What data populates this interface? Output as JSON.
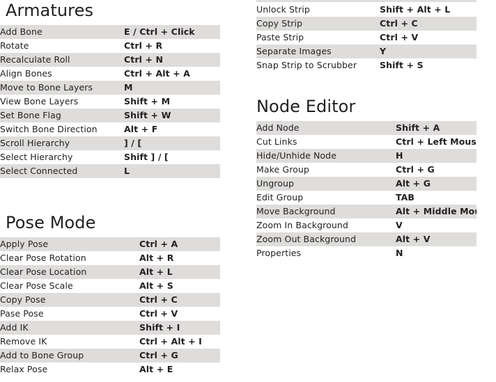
{
  "sections": [
    {
      "id": "armatures",
      "title": "Armatures",
      "rows": [
        {
          "action": "Add Bone",
          "keys": "E / Ctrl + Click"
        },
        {
          "action": "Rotate",
          "keys": "Ctrl + R"
        },
        {
          "action": "Recalculate Roll",
          "keys": "Ctrl + N"
        },
        {
          "action": "Align Bones",
          "keys": "Ctrl + Alt + A"
        },
        {
          "action": "Move to Bone Layers",
          "keys": "M"
        },
        {
          "action": "View Bone Layers",
          "keys": "Shift + M"
        },
        {
          "action": "Set Bone Flag",
          "keys": "Shift + W"
        },
        {
          "action": "Switch Bone Direction",
          "keys": "Alt + F"
        },
        {
          "action": "Scroll Hierarchy",
          "keys": "] / ["
        },
        {
          "action": "Select Hierarchy",
          "keys": "Shift ] / ["
        },
        {
          "action": "Select Connected",
          "keys": "L"
        }
      ]
    },
    {
      "id": "pose-mode",
      "title": "Pose Mode",
      "rows": [
        {
          "action": "Apply Pose",
          "keys": "Ctrl + A"
        },
        {
          "action": "Clear Pose Rotation",
          "keys": "Alt + R"
        },
        {
          "action": "Clear Pose Location",
          "keys": "Alt + L"
        },
        {
          "action": "Clear Pose Scale",
          "keys": "Alt + S"
        },
        {
          "action": "Copy Pose",
          "keys": "Ctrl + C"
        },
        {
          "action": "Pase Pose",
          "keys": "Ctrl + V"
        },
        {
          "action": "Add IK",
          "keys": "Shift + I"
        },
        {
          "action": "Remove IK",
          "keys": "Ctrl + Alt + I"
        },
        {
          "action": "Add to Bone Group",
          "keys": "Ctrl + G"
        },
        {
          "action": "Relax Pose",
          "keys": "Alt + E"
        }
      ]
    },
    {
      "id": "video-sequence-strips",
      "title": "",
      "rows": [
        {
          "action": "Unlock Strip",
          "keys": "Shift + Alt + L"
        },
        {
          "action": "Copy Strip",
          "keys": "Ctrl + C"
        },
        {
          "action": "Paste Strip",
          "keys": "Ctrl + V"
        },
        {
          "action": "Separate Images",
          "keys": "Y"
        },
        {
          "action": "Snap Strip to Scrubber",
          "keys": "Shift + S"
        }
      ]
    },
    {
      "id": "node-editor",
      "title": "Node Editor",
      "rows": [
        {
          "action": "Add Node",
          "keys": "Shift + A"
        },
        {
          "action": "Cut Links",
          "keys": "Ctrl + Left Mouse"
        },
        {
          "action": "Hide/Unhide Node",
          "keys": "H"
        },
        {
          "action": "Make Group",
          "keys": "Ctrl + G"
        },
        {
          "action": "Ungroup",
          "keys": "Alt + G"
        },
        {
          "action": "Edit Group",
          "keys": "TAB"
        },
        {
          "action": "Move Background",
          "keys": "Alt + Middle Mouse"
        },
        {
          "action": "Zoom In Background",
          "keys": "V"
        },
        {
          "action": "Zoom Out Background",
          "keys": "Alt + V"
        },
        {
          "action": "Properties",
          "keys": "N"
        }
      ]
    }
  ],
  "colors": {
    "zebra_row": "#dedddb",
    "page_background": "#ffffff",
    "text": "#231f20"
  }
}
